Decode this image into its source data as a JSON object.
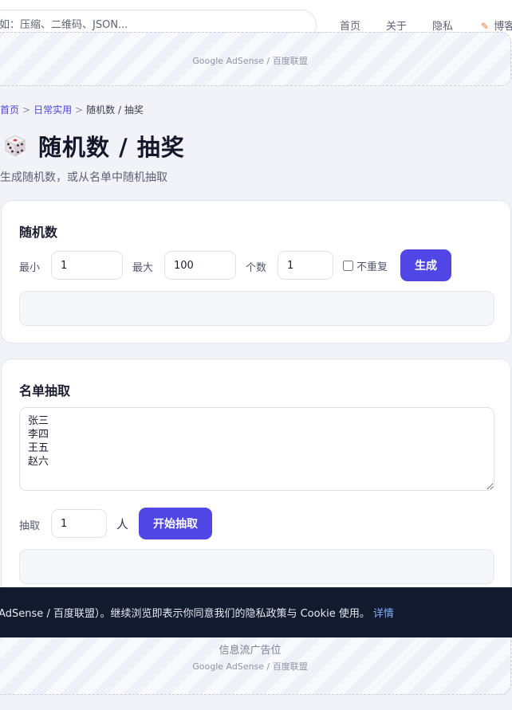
{
  "header": {
    "search_placeholder": "如：压缩、二维码、JSON...",
    "nav": [
      "首页",
      "关于",
      "隐私",
      "博客"
    ]
  },
  "ads": {
    "top_sub": "Google AdSense / 百度联盟",
    "bottom_title": "信息流广告位",
    "bottom_sub": "Google AdSense / 百度联盟"
  },
  "breadcrumb": {
    "home": "首页",
    "category": "日常实用",
    "current": "随机数 / 抽奖",
    "separator": ">"
  },
  "page": {
    "title": "随机数 / 抽奖",
    "subtitle": "生成随机数，或从名单中随机抽取",
    "icon": "dice-icon"
  },
  "random_card": {
    "title": "随机数",
    "min_label": "最小",
    "min_value": "1",
    "max_label": "最大",
    "max_value": "100",
    "count_label": "个数",
    "count_value": "1",
    "unique_label": "不重复",
    "unique_checked": false,
    "generate_label": "生成"
  },
  "draw_card": {
    "title": "名单抽取",
    "names": "张三\n李四\n王五\n赵六",
    "draw_label": "抽取",
    "draw_value": "1",
    "unit": "人",
    "start_label": "开始抽取"
  },
  "cookie": {
    "text": "e AdSense / 百度联盟）。继续浏览即表示你同意我们的隐私政策与 Cookie 使用。",
    "link": "详情"
  },
  "colors": {
    "accent": "#4f46e5",
    "cookie_bg": "#121a2e",
    "link": "#5146d8"
  }
}
